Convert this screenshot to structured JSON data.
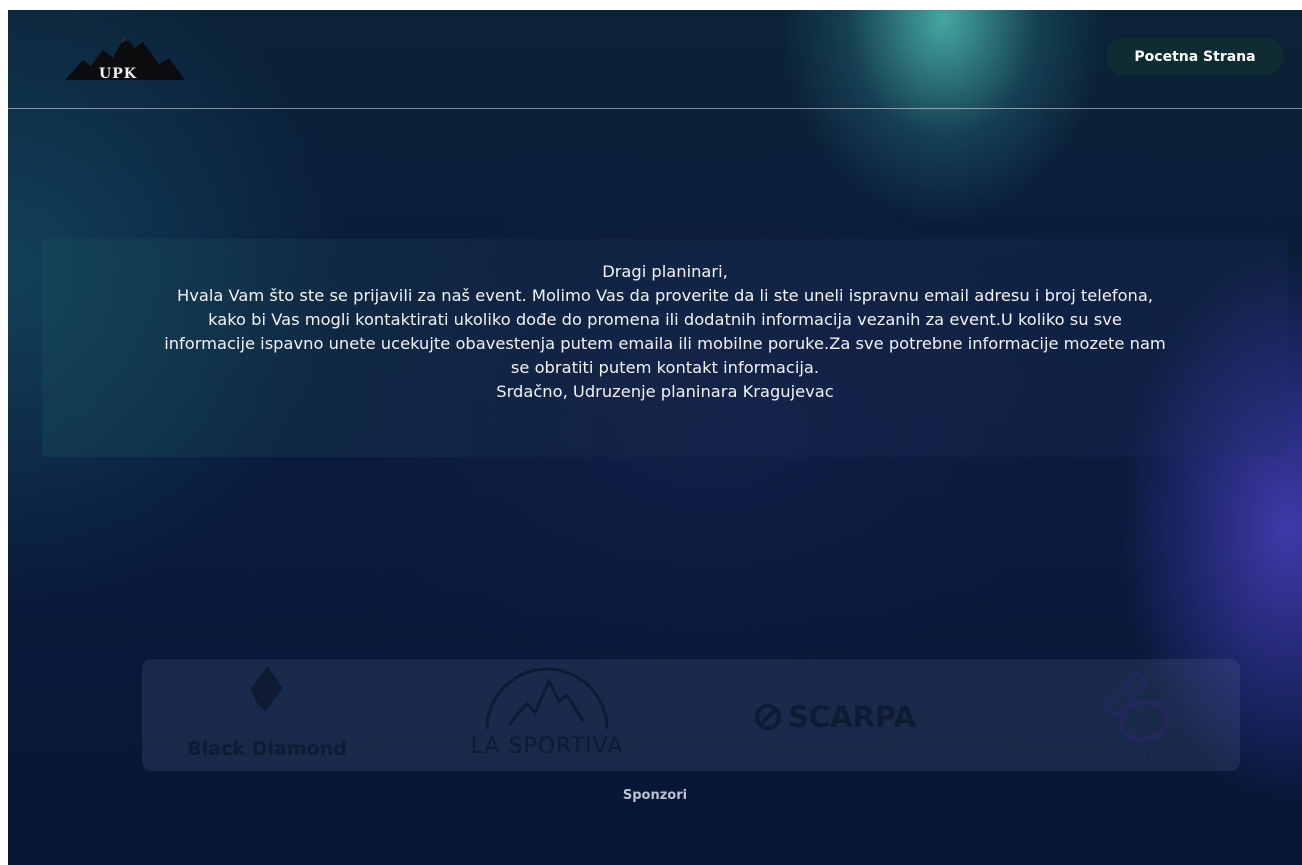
{
  "header": {
    "logo_text": "UPK",
    "home_button_label": "Pocetna Strana"
  },
  "message": {
    "lines": [
      "Dragi planinari,",
      "Hvala Vam što ste se prijavili za naš event. Molimo Vas da proverite da li ste uneli ispravnu email adresu i broj telefona,",
      "kako bi Vas mogli kontaktirati ukoliko dođe do promena ili dodatnih informacija vezanih za event.U koliko su sve",
      "informacije ispavno unete ucekujte obavestenja putem emaila ili mobilne poruke.Za sve potrebne informacije mozete nam",
      "se obratiti putem kontakt informacija.",
      "Srdačno, Udruzenje planinara Kragujevac"
    ]
  },
  "sponsors": {
    "caption": "Sponzori",
    "logos": [
      {
        "name": "Black Diamond",
        "icon": "black-diamond-logo"
      },
      {
        "name": "LA SPORTIVA",
        "icon": "la-sportiva-logo"
      },
      {
        "name": "SCARPA",
        "icon": "scarpa-logo"
      },
      {
        "name": "FIVE TEN",
        "icon": "five-ten-logo"
      }
    ]
  },
  "colors": {
    "button_bg": "#0f2c32",
    "text": "#f1f3f6",
    "sponsor_logo": "#0f1a33",
    "background": "#0a1b3c"
  }
}
